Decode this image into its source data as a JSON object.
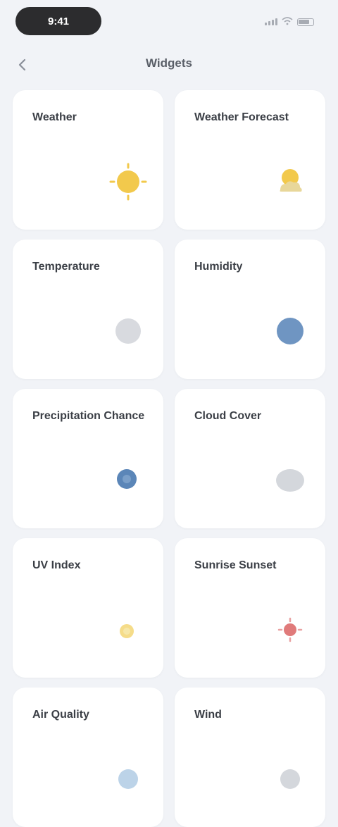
{
  "status_bar": {
    "time": "9:41",
    "battery_level": 0.7
  },
  "nav": {
    "back_icon": "chevron-left-icon",
    "title": "Widgets"
  },
  "cards": [
    {
      "title": "Weather",
      "icon": "sun-icon",
      "icon_color": "#f2c94c"
    },
    {
      "title": "Weather Forecast",
      "icon": "cloud-sun-icon",
      "icon_color": "#f2c94c"
    },
    {
      "title": "Temperature",
      "icon": "thermometer-icon",
      "icon_color": "#b8bcc4"
    },
    {
      "title": "Humidity",
      "icon": "droplet-icon",
      "icon_color": "#6f95c2"
    },
    {
      "title": "Precipitation Chance",
      "icon": "umbrella-icon",
      "icon_color": "#5b86b8"
    },
    {
      "title": "Cloud Cover",
      "icon": "cloud-icon",
      "icon_color": "#b8bcc4"
    },
    {
      "title": "UV Index",
      "icon": "sun-small-icon",
      "icon_color": "#f2d36b"
    },
    {
      "title": "Sunrise Sunset",
      "icon": "sunset-icon",
      "icon_color": "#e07a7a"
    },
    {
      "title": "Air Quality",
      "icon": "leaf-icon",
      "icon_color": "#8fb6d9"
    },
    {
      "title": "Wind",
      "icon": "wind-icon",
      "icon_color": "#b8bcc4"
    }
  ]
}
